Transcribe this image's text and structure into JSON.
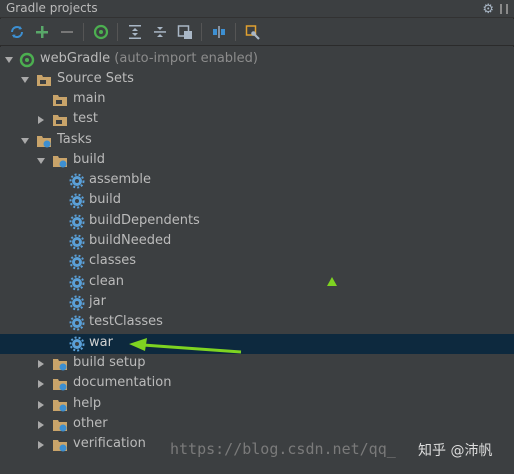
{
  "panel": {
    "title": "Gradle projects"
  },
  "tree": {
    "root_label": "webGradle",
    "root_suffix": "(auto-import enabled)",
    "source_sets": "Source Sets",
    "main": "main",
    "test": "test",
    "tasks": "Tasks",
    "build": "build",
    "build_tasks": [
      "assemble",
      "build",
      "buildDependents",
      "buildNeeded",
      "classes",
      "clean",
      "jar",
      "testClasses",
      "war"
    ],
    "groups": [
      "build setup",
      "documentation",
      "help",
      "other",
      "verification"
    ]
  },
  "watermark": {
    "url": "https://blog.csdn.net/qq_",
    "brand": "知乎 @沛帆"
  },
  "colors": {
    "background": "#3c3f41",
    "selection": "#0d293e",
    "accent": "#4caf50",
    "text": "#bbbbbb"
  }
}
